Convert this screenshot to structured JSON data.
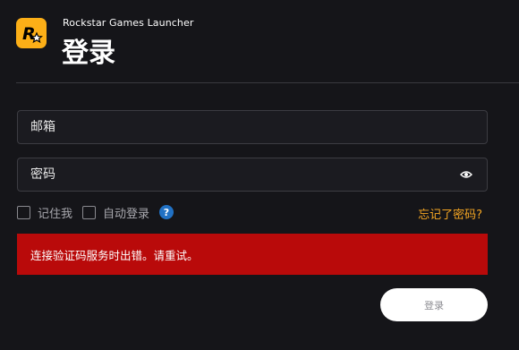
{
  "app": {
    "name": "Rockstar Games Launcher",
    "logo_icon": "rockstar-logo-icon",
    "logo_color": "#fcaf17"
  },
  "page": {
    "title": "登录"
  },
  "form": {
    "email_placeholder": "邮箱",
    "email_value": "",
    "password_placeholder": "密码",
    "password_value": "",
    "password_toggle_icon": "eye-icon",
    "remember_label": "记住我",
    "remember_checked": false,
    "autologin_label": "自动登录",
    "autologin_checked": false,
    "help_icon": "question-mark-icon",
    "help_symbol": "?",
    "forgot_label": "忘记了密码?",
    "submit_label": "登录"
  },
  "error": {
    "message": "连接验证码服务时出错。请重试。",
    "color": "#b90a0a"
  },
  "colors": {
    "background": "#151519",
    "accent_link": "#f5a623",
    "help_blue": "#2171c4"
  }
}
